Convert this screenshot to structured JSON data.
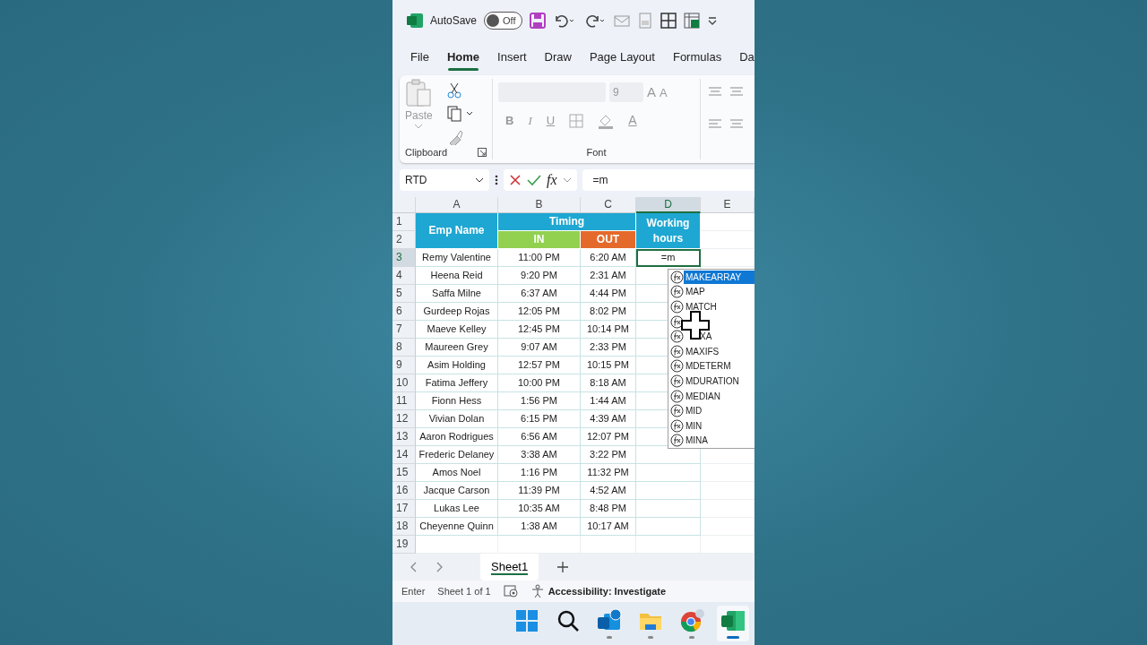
{
  "title_bar": {
    "autosave_label": "AutoSave",
    "autosave": {
      "on": false,
      "label": "Off"
    }
  },
  "ribbon_tabs": [
    {
      "label": "File",
      "selected": false
    },
    {
      "label": "Home",
      "selected": true
    },
    {
      "label": "Insert",
      "selected": false
    },
    {
      "label": "Draw",
      "selected": false
    },
    {
      "label": "Page Layout",
      "selected": false
    },
    {
      "label": "Formulas",
      "selected": false
    },
    {
      "label": "Da",
      "selected": false
    }
  ],
  "ribbon": {
    "paste_label": "Paste",
    "clipboard_label": "Clipboard",
    "font_size": "9",
    "grow_font": "A",
    "shrink_font": "A",
    "bold": "B",
    "italic": "I",
    "underline": "U",
    "font_color": "A",
    "font_label": "Font"
  },
  "formula_bar": {
    "name_box": "RTD",
    "fx": "fx",
    "formula": "=m"
  },
  "columns": [
    {
      "label": "A",
      "selected": false
    },
    {
      "label": "B",
      "selected": false
    },
    {
      "label": "C",
      "selected": false
    },
    {
      "label": "D",
      "selected": true
    },
    {
      "label": "E",
      "selected": false
    }
  ],
  "header": {
    "emp_name": "Emp Name",
    "timing": "Timing",
    "in": "IN",
    "out": "OUT",
    "working_hours": "Working hours",
    "rows": [
      "1",
      "2"
    ]
  },
  "rows": [
    {
      "row": "3",
      "name": "Remy Valentine",
      "in": "11:00 PM",
      "out": "6:20 AM",
      "hours": "=m",
      "active": true
    },
    {
      "row": "4",
      "name": "Heena Reid",
      "in": "9:20 PM",
      "out": "2:31 AM",
      "active": false
    },
    {
      "row": "5",
      "name": "Saffa Milne",
      "in": "6:37 AM",
      "out": "4:44 PM",
      "active": false
    },
    {
      "row": "6",
      "name": "Gurdeep Rojas",
      "in": "12:05 PM",
      "out": "8:02 PM",
      "active": false
    },
    {
      "row": "7",
      "name": "Maeve Kelley",
      "in": "12:45 PM",
      "out": "10:14 PM",
      "active": false
    },
    {
      "row": "8",
      "name": "Maureen Grey",
      "in": "9:07 AM",
      "out": "2:33 PM",
      "active": false
    },
    {
      "row": "9",
      "name": "Asim Holding",
      "in": "12:57 PM",
      "out": "10:15 PM",
      "active": false
    },
    {
      "row": "10",
      "name": "Fatima Jeffery",
      "in": "10:00 PM",
      "out": "8:18 AM",
      "active": false
    },
    {
      "row": "11",
      "name": "Fionn Hess",
      "in": "1:56 PM",
      "out": "1:44 AM",
      "active": false
    },
    {
      "row": "12",
      "name": "Vivian Dolan",
      "in": "6:15 PM",
      "out": "4:39 AM",
      "active": false
    },
    {
      "row": "13",
      "name": "Aaron Rodrigues",
      "in": "6:56 AM",
      "out": "12:07 PM",
      "active": false
    },
    {
      "row": "14",
      "name": "Frederic Delaney",
      "in": "3:38 AM",
      "out": "3:22 PM",
      "active": false
    },
    {
      "row": "15",
      "name": "Amos Noel",
      "in": "1:16 PM",
      "out": "11:32 PM",
      "active": false
    },
    {
      "row": "16",
      "name": "Jacque Carson",
      "in": "11:39 PM",
      "out": "4:52 AM",
      "active": false
    },
    {
      "row": "17",
      "name": "Lukas Lee",
      "in": "10:35 AM",
      "out": "8:48 PM",
      "active": false
    },
    {
      "row": "18",
      "name": "Cheyenne Quinn",
      "in": "1:38 AM",
      "out": "10:17 AM",
      "active": false
    }
  ],
  "empty_rows": [
    "19"
  ],
  "autocomplete": [
    {
      "label": "MAKEARRAY",
      "selected": true
    },
    {
      "label": "MAP",
      "selected": false
    },
    {
      "label": "MATCH",
      "selected": false
    },
    {
      "selected": false
    },
    {
      "label": "XA",
      "selected": false
    },
    {
      "label": "MAXIFS",
      "selected": false
    },
    {
      "label": "MDETERM",
      "selected": false
    },
    {
      "label": "MDURATION",
      "selected": false
    },
    {
      "label": "MEDIAN",
      "selected": false
    },
    {
      "label": "MID",
      "selected": false
    },
    {
      "label": "MIN",
      "selected": false
    },
    {
      "label": "MINA",
      "selected": false
    }
  ],
  "sheet_tabs": [
    {
      "label": "Sheet1",
      "selected": true
    }
  ],
  "status_bar": {
    "mode": "Enter",
    "sheet": "Sheet 1 of 1",
    "accessibility": "Accessibility: Investigate"
  },
  "taskbar": [
    {
      "kind": "start",
      "running": false
    },
    {
      "kind": "search",
      "running": false
    },
    {
      "kind": "mail",
      "running": true
    },
    {
      "kind": "folder",
      "running": true
    },
    {
      "kind": "browser",
      "running": true
    },
    {
      "kind": "sheet",
      "running": true,
      "active": true
    }
  ]
}
